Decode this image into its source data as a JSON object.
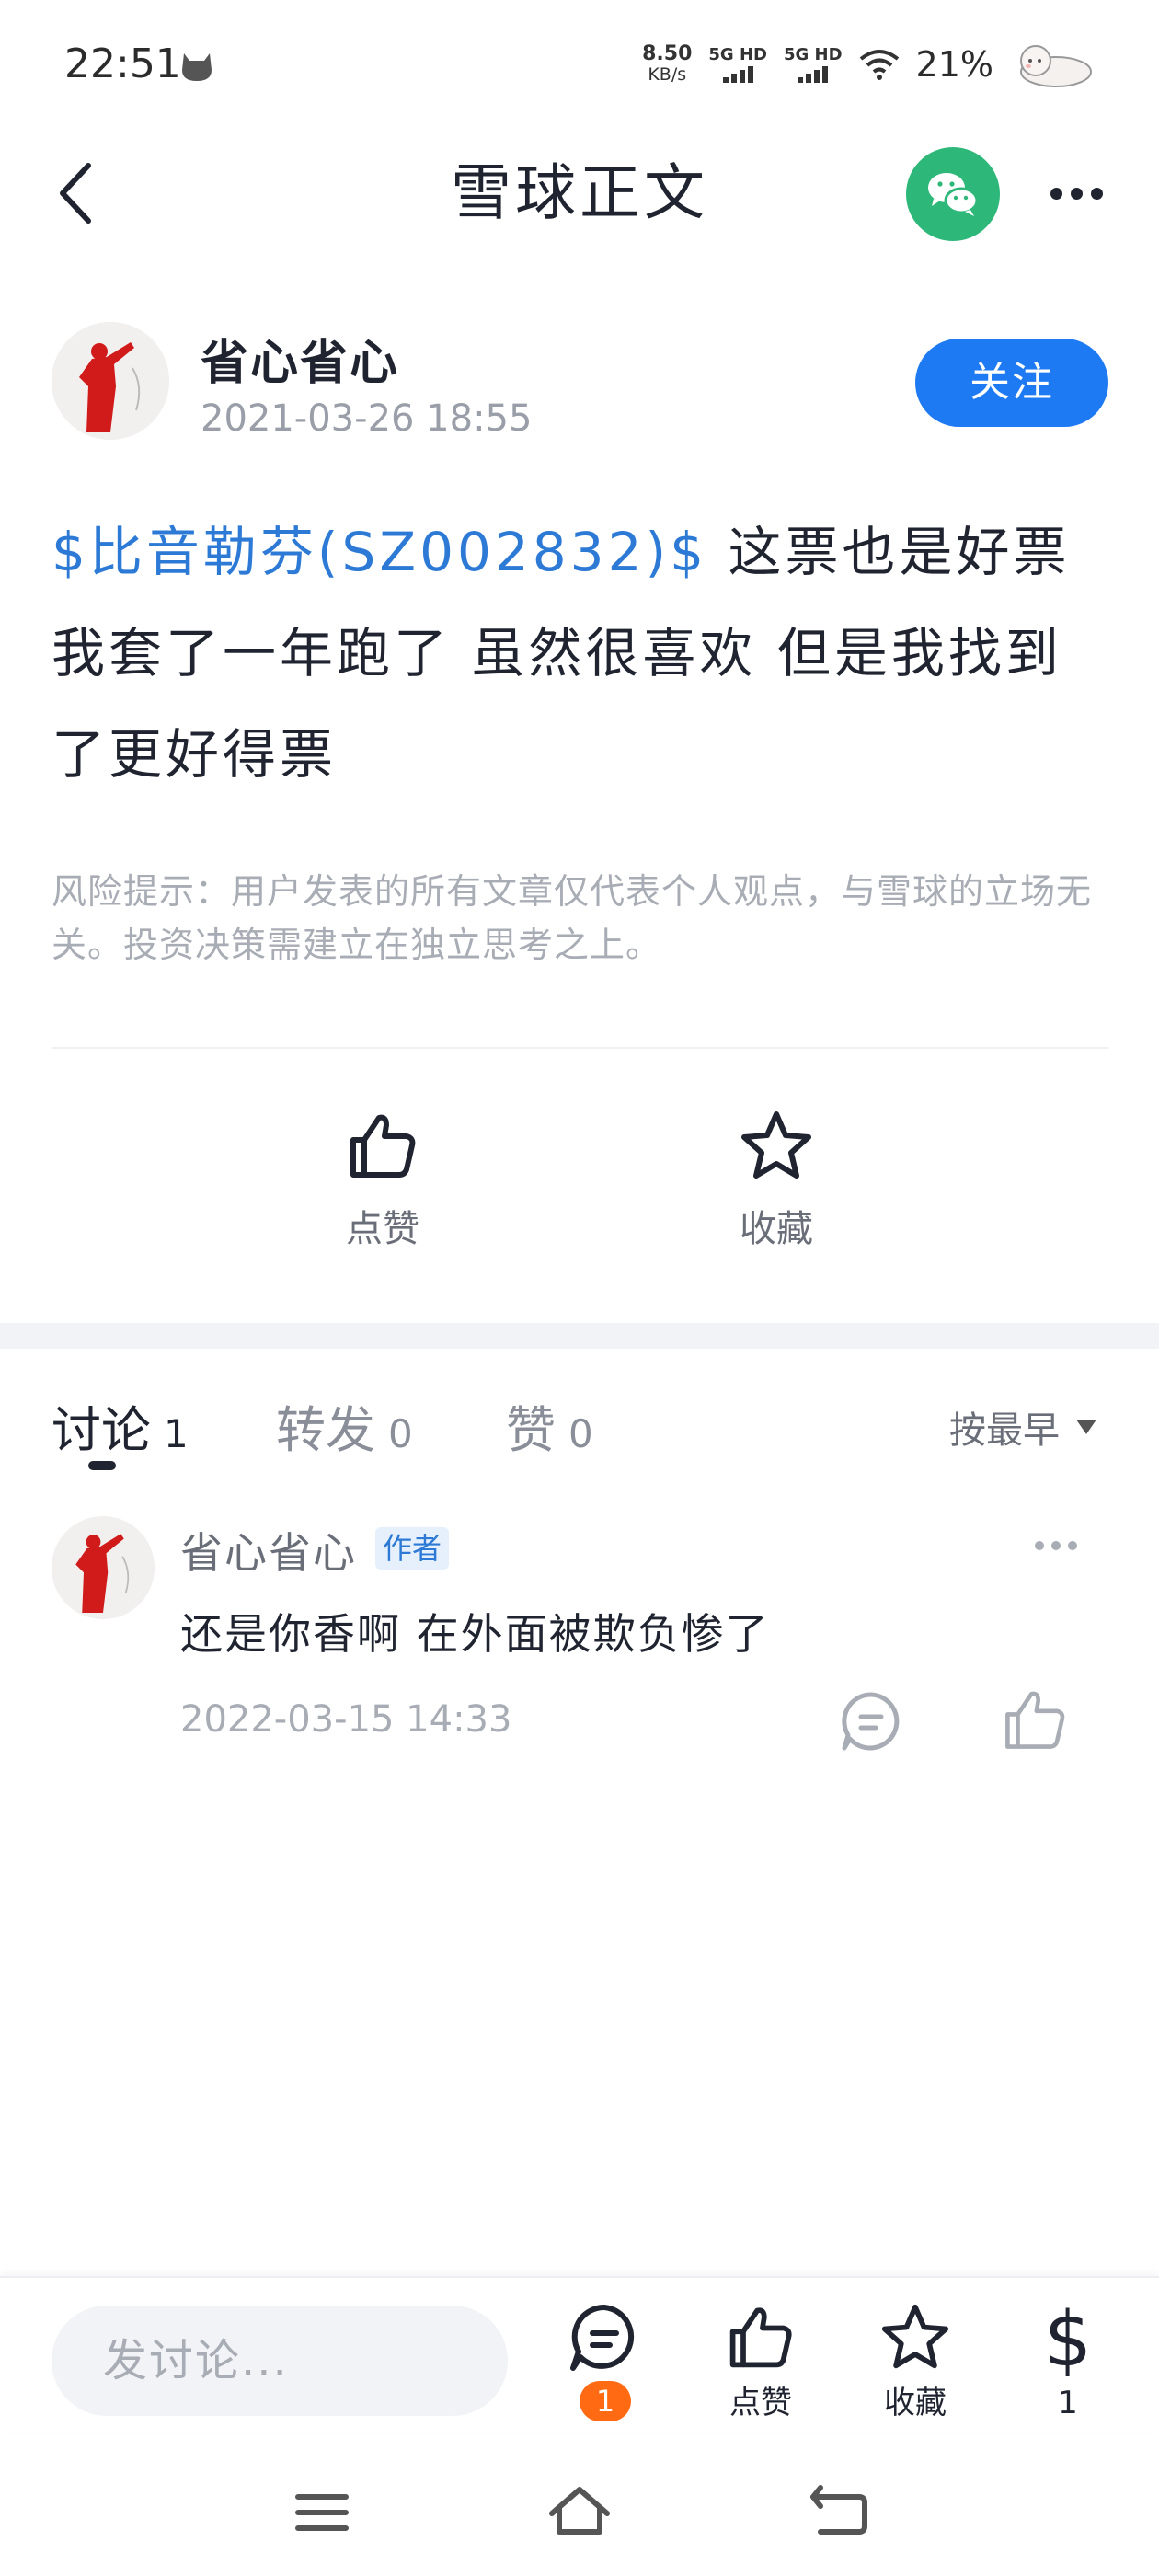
{
  "status_bar": {
    "time": "22:51",
    "net_speed_value": "8.50",
    "net_speed_unit": "KB/s",
    "sim1_label": "5G HD",
    "sim2_label": "5G HD",
    "battery_percent": "21%"
  },
  "header": {
    "title": "雪球正文"
  },
  "author": {
    "name": "省心省心",
    "date": "2021-03-26 18:55",
    "follow_label": "关注"
  },
  "post": {
    "stock_link": "$比音勒芬(SZ002832)$",
    "text": " 这票也是好票我套了一年跑了 虽然很喜欢 但是我找到了更好得票",
    "risk_notice": "风险提示：用户发表的所有文章仅代表个人观点，与雪球的立场无关。投资决策需建立在独立思考之上。"
  },
  "actions": {
    "like_label": "点赞",
    "favorite_label": "收藏"
  },
  "tabs": {
    "discuss_label": "讨论",
    "discuss_count": "1",
    "repost_label": "转发",
    "repost_count": "0",
    "like_label": "赞",
    "like_count": "0",
    "sort_label": "按最早"
  },
  "comments": [
    {
      "name": "省心省心",
      "badge": "作者",
      "text": "还是你香啊 在外面被欺负惨了",
      "date": "2022-03-15 14:33"
    }
  ],
  "bottom_bar": {
    "input_placeholder": "发讨论...",
    "discuss_badge": "1",
    "like_label": "点赞",
    "favorite_label": "收藏",
    "reward_symbol": "$",
    "reward_count": "1"
  },
  "colors": {
    "accent_blue": "#1d7af3",
    "link_blue": "#2d7ad6",
    "wechat_green": "#2db87a",
    "badge_orange": "#ff6a13"
  },
  "icons": [
    "cat-icon",
    "wifi-icon",
    "back-arrow-icon",
    "wechat-icon",
    "more-icon",
    "thumbs-up-icon",
    "star-icon",
    "comment-icon",
    "dollar-icon",
    "menu-icon",
    "home-icon",
    "system-back-icon"
  ]
}
